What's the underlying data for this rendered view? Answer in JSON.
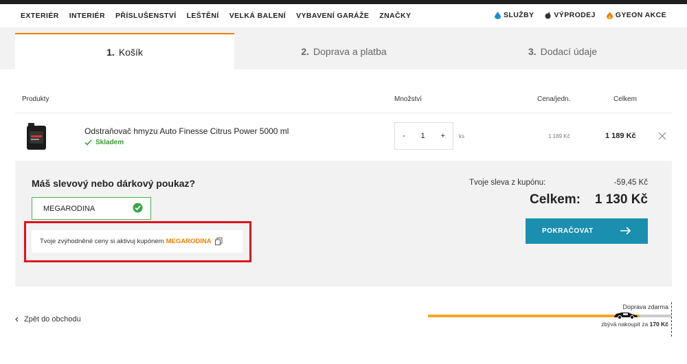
{
  "nav": {
    "left": [
      "EXTERIÉR",
      "INTERIÉR",
      "PŘÍSLUŠENSTVÍ",
      "LEŠTĚNÍ",
      "VELKÁ BALENÍ",
      "VYBAVENÍ GARÁŽE",
      "ZNAČKY"
    ],
    "right": [
      {
        "label": "SLUŽBY",
        "icon": "water-drop-icon"
      },
      {
        "label": "VÝPRODEJ",
        "icon": "bomb-icon"
      },
      {
        "label": "GYEON AKCE",
        "icon": "fire-icon"
      }
    ]
  },
  "steps": [
    {
      "num": "1.",
      "label": "Košík"
    },
    {
      "num": "2.",
      "label": "Doprava a platba"
    },
    {
      "num": "3.",
      "label": "Dodací údaje"
    }
  ],
  "table": {
    "headers": {
      "products": "Produkty",
      "quantity": "Množství",
      "unit_price": "Cena/jedn.",
      "total": "Celkem"
    }
  },
  "item": {
    "name": "Odstraňovač hmyzu Auto Finesse Citrus Power 5000 ml",
    "stock": "Skladem",
    "minus": "-",
    "qty": "1",
    "plus": "+",
    "unit": "ks",
    "unit_price": "1 189 Kč",
    "total": "1 189 Kč"
  },
  "coupon": {
    "title": "Máš slevový nebo dárkový poukaz?",
    "value": "MEGARODINA",
    "promo_text": "Tvoje zvýhodněné ceny si aktivuj kupónem",
    "promo_code": "MEGARODINA"
  },
  "summary": {
    "discount_label": "Tvoje sleva z kupónu:",
    "discount_value": "-59,45 Kč",
    "total_label": "Celkem:",
    "total_value": "1 130 Kč",
    "continue_label": "POKRAČOVAT"
  },
  "footer": {
    "back_label": "Zpět do obchodu",
    "free_shipping_label": "Doprava zdarma",
    "remaining_prefix": "zbývá nakoupit za",
    "remaining_value": "170 Kč",
    "free_shipping_progress": 0.87
  },
  "colors": {
    "accent": "#f07e00",
    "button": "#1a8fb0",
    "success": "#3a9a3a",
    "highlight": "#e0101c"
  }
}
